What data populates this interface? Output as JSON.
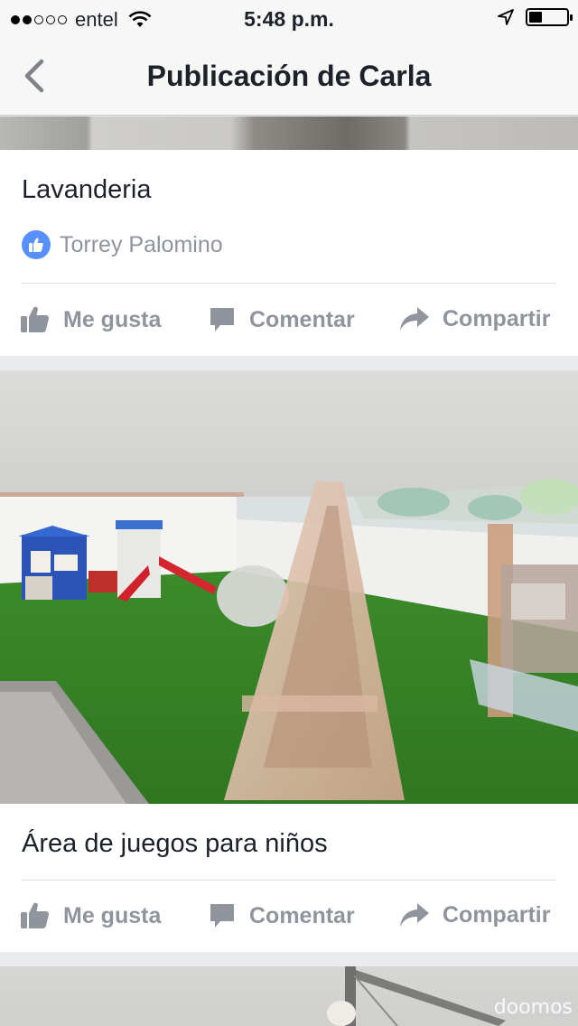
{
  "status_bar": {
    "carrier": "entel",
    "time": "5:48 p.m.",
    "battery_level": 0.35,
    "signal_bars_filled": 2,
    "signal_bars_total": 5
  },
  "nav": {
    "title": "Publicación de Carla",
    "back_icon": "chevron-left-icon"
  },
  "posts": [
    {
      "title": "Lavanderia",
      "liked_by": "Torrey Palomino",
      "actions": {
        "like": "Me gusta",
        "comment": "Comentar",
        "share": "Compartir"
      }
    },
    {
      "title": "Área de juegos para niños",
      "actions": {
        "like": "Me gusta",
        "comment": "Comentar",
        "share": "Compartir"
      }
    }
  ],
  "watermark": "doomos",
  "colors": {
    "accent": "#5890ff",
    "muted_text": "#90949c",
    "text": "#1d2129",
    "turf": "#3f8a2c"
  }
}
